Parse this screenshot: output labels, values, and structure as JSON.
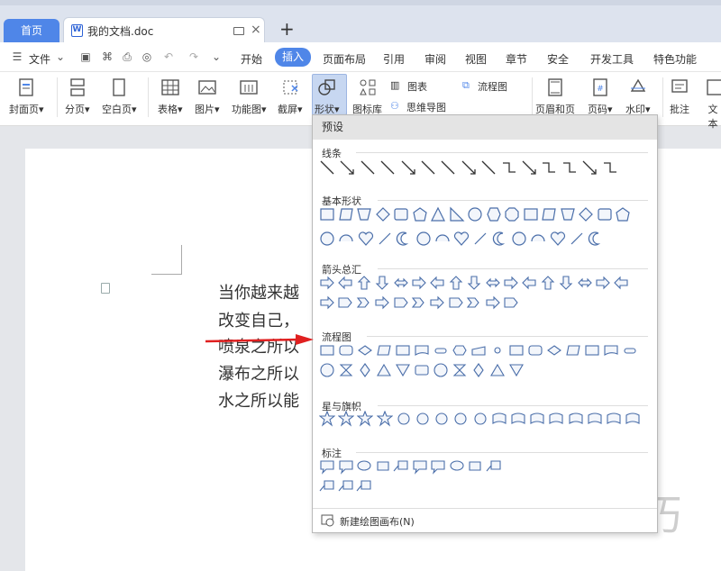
{
  "tabs": {
    "home": "首页",
    "doc_title": "我的文档.doc"
  },
  "file_menu": "文件",
  "menu": [
    "开始",
    "插入",
    "页面布局",
    "引用",
    "审阅",
    "视图",
    "章节",
    "安全",
    "开发工具",
    "特色功能"
  ],
  "active_menu": "插入",
  "ribbon": {
    "cover": "封面页",
    "pagebreak": "分页",
    "blank": "空白页",
    "table": "表格",
    "picture": "图片",
    "function": "功能图",
    "screenshot": "截屏",
    "shape": "形状",
    "iconlib": "图标库",
    "chart": "图表",
    "flowchart": "流程图",
    "mindmap": "思维导图",
    "header_footer": "页眉和页脚",
    "page_num": "页码",
    "watermark": "水印",
    "comment": "批注",
    "text": "文本"
  },
  "document_lines": [
    "当你越来越",
    "改变自己，",
    "喷泉之所以",
    "瀑布之所以",
    "水之所以能"
  ],
  "shape_panel": {
    "preset": "预设",
    "sections": [
      "线条",
      "基本形状",
      "箭头总汇",
      "流程图",
      "星与旗帜",
      "标注"
    ],
    "new_canvas": "新建绘图画布(N)"
  },
  "watermark_text": "软件技巧",
  "colors": {
    "accent": "#4f86e8",
    "shape_stroke": "#4a6ea9",
    "arrow": "#e02020"
  }
}
